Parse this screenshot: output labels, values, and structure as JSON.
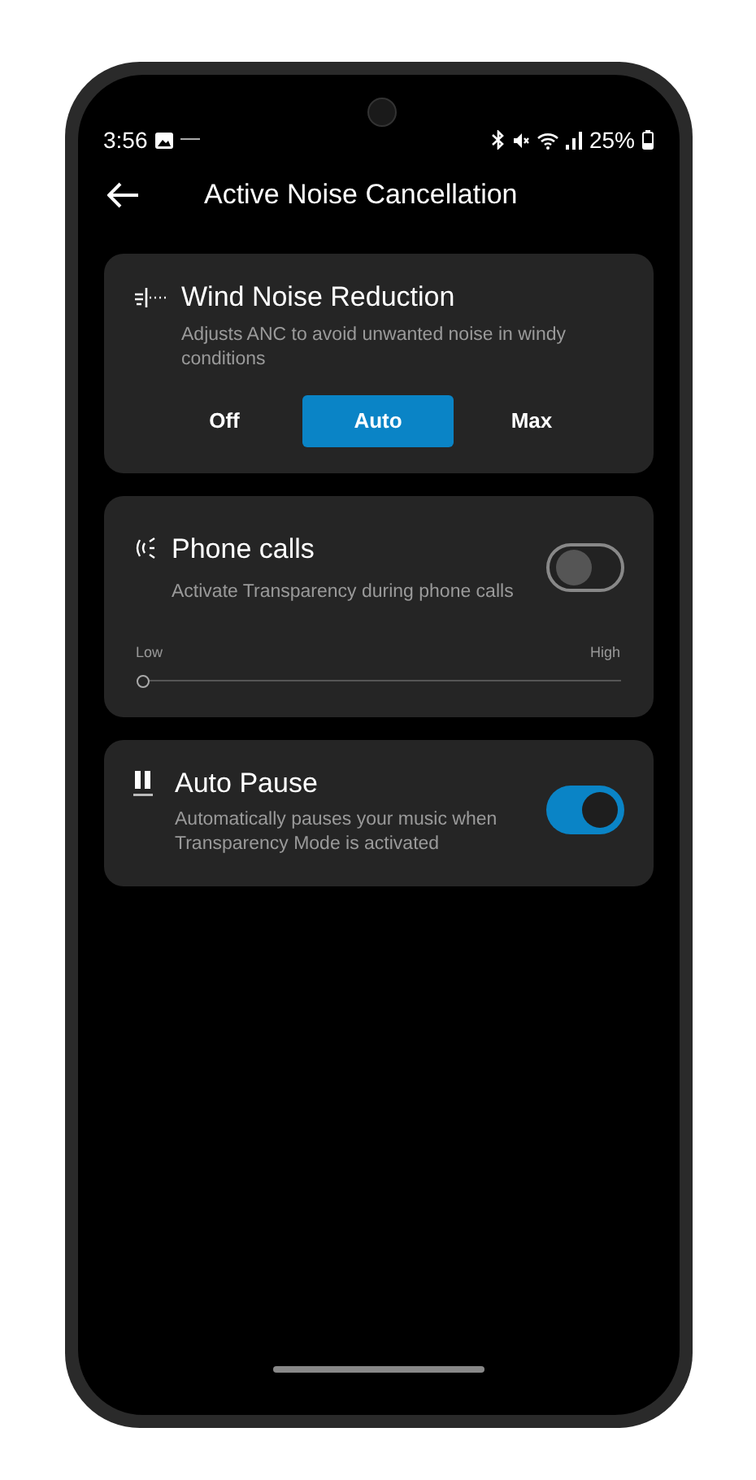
{
  "status_bar": {
    "time": "3:56",
    "battery": "25%"
  },
  "header": {
    "title": "Active Noise Cancellation"
  },
  "wind": {
    "title": "Wind Noise Reduction",
    "description": "Adjusts ANC to avoid unwanted noise in windy conditions",
    "options": [
      {
        "label": "Off",
        "selected": false
      },
      {
        "label": "Auto",
        "selected": true
      },
      {
        "label": "Max",
        "selected": false
      }
    ]
  },
  "phone_calls": {
    "title": "Phone calls",
    "description": "Activate Transparency during phone calls",
    "on": false,
    "slider": {
      "min_label": "Low",
      "max_label": "High",
      "level": 0
    }
  },
  "auto_pause": {
    "title": "Auto Pause",
    "description": "Automatically pauses your music when Transparency Mode is activated",
    "on": true
  }
}
